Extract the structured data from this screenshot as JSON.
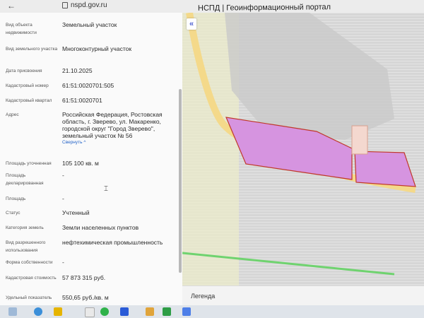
{
  "browser": {
    "url": "nspd.gov.ru"
  },
  "portal": {
    "title": "НСПД | Геоинформационный портал"
  },
  "details": [
    {
      "label": "Вид объекта недвижимости",
      "value": ""
    },
    {
      "label": "Вид земельного участка",
      "value": ""
    },
    {
      "label": "Дата присвоения",
      "value": "21.10.2025"
    },
    {
      "label": "Кадастровый номер",
      "value": "61:51:0020701:505"
    },
    {
      "label": "Кадастровый квартал",
      "value": "61:51:0020701"
    },
    {
      "label": "Адрес",
      "value": ""
    },
    {
      "label": "Площадь уточненная",
      "value": "105 100 кв. м"
    },
    {
      "label": "Площадь декларированная",
      "value": "-"
    },
    {
      "label": "Площадь",
      "value": "-"
    },
    {
      "label": "Статус",
      "value": "Учтенный"
    },
    {
      "label": "Категория земель",
      "value": "Земли населенных пунктов"
    },
    {
      "label": "Вид разрешенного использования",
      "value": "нефтехимическая промышленность"
    },
    {
      "label": "Форма собственности",
      "value": "-"
    },
    {
      "label": "Кадастровая стоимость",
      "value": "57 873 315 руб."
    },
    {
      "label": "Удельный показатель",
      "value": "550,65 руб./кв. м"
    }
  ],
  "values_multiline": {
    "object_type": "Земельный участок",
    "parcel_type": "Многоконтурный участок",
    "address_lines": [
      "Российская Федерация, Ростовская",
      "область, г. Зверево, ул. Макаренко,",
      "городской округ \"Город Зверево\",",
      "земельный участок № 56"
    ]
  },
  "collapse_label": "Свернуть ^",
  "map": {
    "collapse_button": "«",
    "legend_label": "Легенда"
  },
  "colors": {
    "accent": "#2463c8",
    "parcel_fill": "#d694e0",
    "parcel_border": "#c0392b",
    "road": "#f1e8b0",
    "green_line": "#6fd36f"
  }
}
